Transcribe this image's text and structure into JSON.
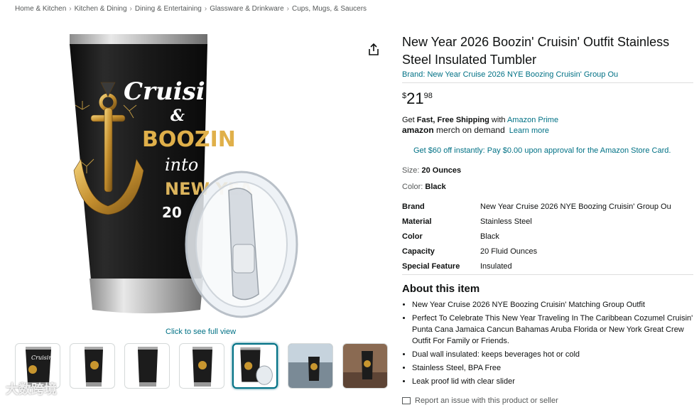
{
  "breadcrumb": [
    "Home & Kitchen",
    "Kitchen & Dining",
    "Dining & Entertaining",
    "Glassware & Drinkware",
    "Cups, Mugs, & Saucers"
  ],
  "breadcrumb_sep": "›",
  "image": {
    "art_line1": "Cruisin",
    "art_line2": "&",
    "art_line3": "BOOZIN",
    "art_line4": "into the",
    "art_line5": "NEW YEA",
    "art_line6": "20",
    "full_view_label": "Click to see full view"
  },
  "thumbnails_count": 7,
  "watermark": "大数跨境",
  "product": {
    "title": "New Year 2026 Boozin' Cruisin' Outfit Stainless Steel Insulated Tumbler",
    "brand_link": "Brand: New Year Cruise 2026 NYE Boozing Cruisin' Group Ou",
    "price_symbol": "$",
    "price_whole": "21",
    "price_fraction": "98"
  },
  "shipping": {
    "get": "Get ",
    "fast_free": "Fast, Free Shipping",
    "with": " with ",
    "prime": "Amazon Prime"
  },
  "merch": {
    "amazon": "amazon",
    "text": " merch on demand",
    "learn_more": "Learn more"
  },
  "promo": "Get $60 off instantly: Pay $0.00 upon approval for the Amazon Store Card.",
  "size": {
    "label": "Size: ",
    "value": "20 Ounces"
  },
  "color": {
    "label": "Color: ",
    "value": "Black"
  },
  "specs": [
    {
      "key": "Brand",
      "value": "New Year Cruise 2026 NYE Boozing Cruisin' Group Ou"
    },
    {
      "key": "Material",
      "value": "Stainless Steel"
    },
    {
      "key": "Color",
      "value": "Black"
    },
    {
      "key": "Capacity",
      "value": "20 Fluid Ounces"
    },
    {
      "key": "Special Feature",
      "value": "Insulated"
    }
  ],
  "about": {
    "title": "About this item",
    "items": [
      "New Year Cruise 2026 NYE Boozing Cruisin' Matching Group Outfit",
      "Perfect To Celebrate This New Year Traveling In The Caribbean Cozumel Cruisin' Punta Cana Jamaica Cancun Bahamas Aruba Florida or New York Great Crew Outfit For Family or Friends.",
      "Dual wall insulated: keeps beverages hot or cold",
      "Stainless Steel, BPA Free",
      "Leak proof lid with clear slider"
    ]
  },
  "report": "Report an issue with this product or seller",
  "colors": {
    "link": "#007185",
    "text": "#0f1111",
    "tumbler": "#1a1a1a",
    "gold": "#d9a640"
  }
}
